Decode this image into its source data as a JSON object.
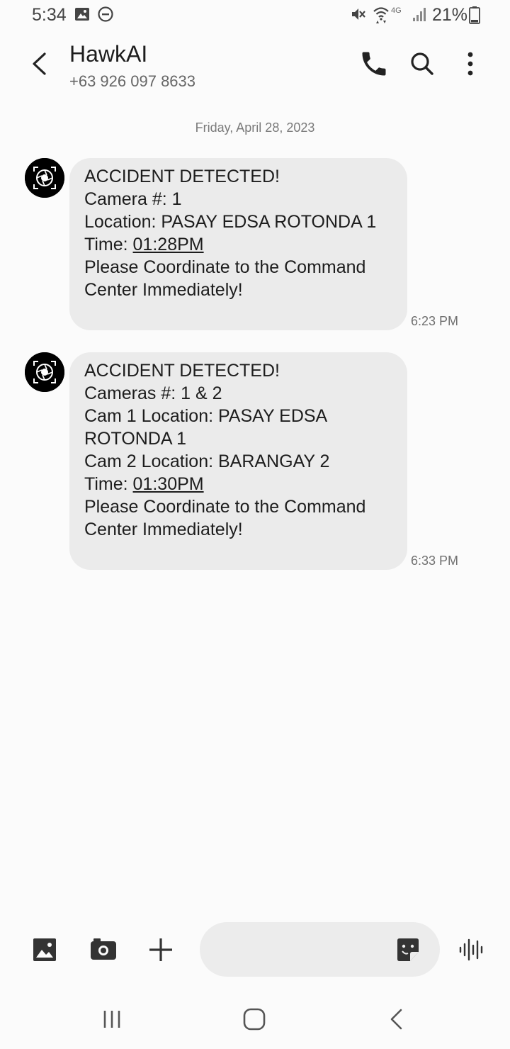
{
  "status_bar": {
    "time": "5:34",
    "battery_percent": "21%",
    "network_label": "4G",
    "icons": [
      "gallery-notification-icon",
      "do-not-disturb-icon",
      "mute-icon",
      "wifi-icon",
      "signal-icon",
      "battery-icon"
    ]
  },
  "header": {
    "contact_name": "HawkAI",
    "contact_number": "+63 926 097 8633",
    "icons": [
      "back-arrow-icon",
      "phone-icon",
      "search-icon",
      "more-vert-icon"
    ]
  },
  "date_divider": "Friday, April 28, 2023",
  "messages": [
    {
      "avatar_icon": "hawkai-logo-icon",
      "line1": "ACCIDENT DETECTED!",
      "line2": "Camera #: 1",
      "line3": "Location: PASAY EDSA ROTONDA 1",
      "line4_prefix": "Time: ",
      "line4_link": "01:28PM",
      "line5": "Please Coordinate to the Command",
      "line6": "Center Immediately!",
      "time": "6:23 PM"
    },
    {
      "avatar_icon": "hawkai-logo-icon",
      "line1": "ACCIDENT DETECTED!",
      "line2": "Cameras #: 1 & 2",
      "line3": "Cam 1 Location: PASAY EDSA",
      "line4": "ROTONDA 1",
      "line5": "Cam 2 Location: BARANGAY 2",
      "line6_prefix": "Time: ",
      "line6_link": "01:30PM",
      "line7": "Please Coordinate to the Command",
      "line8": "Center Immediately!",
      "time": "6:33 PM"
    }
  ],
  "composer": {
    "placeholder": "",
    "value": "",
    "icons": [
      "gallery-icon",
      "camera-icon",
      "add-icon",
      "sticker-icon",
      "voice-record-icon"
    ]
  },
  "nav_bar": {
    "icons": [
      "recent-apps-icon",
      "home-icon",
      "nav-back-icon"
    ]
  },
  "colors": {
    "background": "#fbfbfb",
    "bubble": "#ebebeb",
    "text": "#1d1d1d",
    "secondary_text": "#6f6f6f",
    "icon": "#333333"
  }
}
